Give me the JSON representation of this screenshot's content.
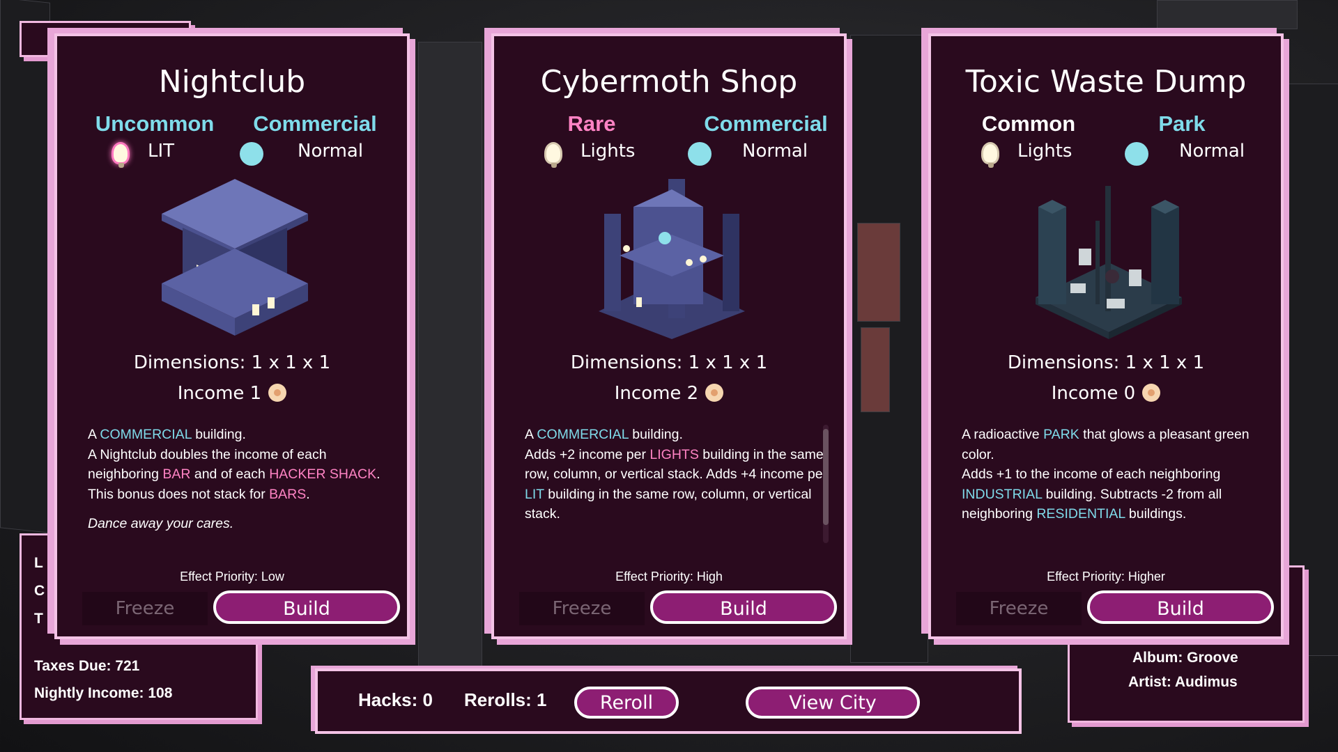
{
  "cards": [
    {
      "title": "Nightclub",
      "rarity": "Uncommon",
      "type": "Commercial",
      "light_label": "LIT",
      "light_state": "lit",
      "zone_label": "Normal",
      "dimensions": "Dimensions: 1 x 1 x 1",
      "income": "Income 1",
      "desc_parts": [
        [
          "A ",
          "n"
        ],
        [
          "COMMERCIAL",
          "c"
        ],
        [
          " building.",
          "n"
        ],
        [
          "\n",
          "n"
        ],
        [
          "A Nightclub doubles the income of each neighboring  ",
          "n"
        ],
        [
          "BAR",
          "p"
        ],
        [
          " and of each ",
          "n"
        ],
        [
          "HACKER SHACK",
          "p"
        ],
        [
          ".",
          "n"
        ],
        [
          "\n",
          "n"
        ],
        [
          "This bonus does not stack for ",
          "n"
        ],
        [
          "BARS",
          "p"
        ],
        [
          ".",
          "n"
        ]
      ],
      "flavor": "Dance away your cares.",
      "priority": "Effect Priority: Low",
      "freeze_label": "Freeze",
      "build_label": "Build"
    },
    {
      "title": "Cybermoth Shop",
      "rarity": "Rare",
      "type": "Commercial",
      "light_label": "Lights",
      "light_state": "lights",
      "zone_label": "Normal",
      "dimensions": "Dimensions: 1 x 1 x 1",
      "income": "Income 2",
      "desc_parts": [
        [
          "A  ",
          "n"
        ],
        [
          "COMMERCIAL",
          "c"
        ],
        [
          " building.",
          "n"
        ],
        [
          "\n",
          "n"
        ],
        [
          "Adds +2 income per ",
          "n"
        ],
        [
          "LIGHTS",
          "p"
        ],
        [
          " building in the same row, column, or vertical stack. Adds +4 income per ",
          "n"
        ],
        [
          "LIT",
          "c"
        ],
        [
          " building in the same row, column, or vertical stack.",
          "n"
        ]
      ],
      "flavor": "",
      "priority": "Effect Priority: High",
      "freeze_label": "Freeze",
      "build_label": "Build"
    },
    {
      "title": "Toxic Waste Dump",
      "rarity": "Common",
      "type": "Park",
      "light_label": "Lights",
      "light_state": "lights",
      "zone_label": "Normal",
      "dimensions": "Dimensions: 1 x 1 x 1",
      "income": "Income 0",
      "desc_parts": [
        [
          "A radioactive ",
          "n"
        ],
        [
          "PARK",
          "c"
        ],
        [
          " that glows a pleasant green color.",
          "n"
        ],
        [
          "\n",
          "n"
        ],
        [
          "Adds +1 to the income of each neighboring ",
          "n"
        ],
        [
          "INDUSTRIAL",
          "c"
        ],
        [
          " building. Subtracts -2 from all neighboring ",
          "n"
        ],
        [
          "RESIDENTIAL",
          "c"
        ],
        [
          " buildings.",
          "n"
        ]
      ],
      "flavor": "",
      "priority": "Effect Priority: Higher",
      "freeze_label": "Freeze",
      "build_label": "Build"
    }
  ],
  "bottom_bar": {
    "hacks": "Hacks: 0",
    "rerolls": "Rerolls: 1",
    "reroll_label": "Reroll",
    "view_city_label": "View City"
  },
  "left_panel": {
    "taxes_due": "Taxes Due: 721",
    "nightly_income": "Nightly Income: 108",
    "partial_rows": [
      "L",
      "C",
      "T"
    ]
  },
  "right_panel": {
    "album": "Album: Groove",
    "artist": "Artist: Audimus"
  },
  "colors": {
    "card_bg": "#2a0a1e",
    "border": "#f4c3e6",
    "accent_cyan": "#7fdbea",
    "accent_pink": "#ff83c4",
    "button": "#8d1e73"
  }
}
